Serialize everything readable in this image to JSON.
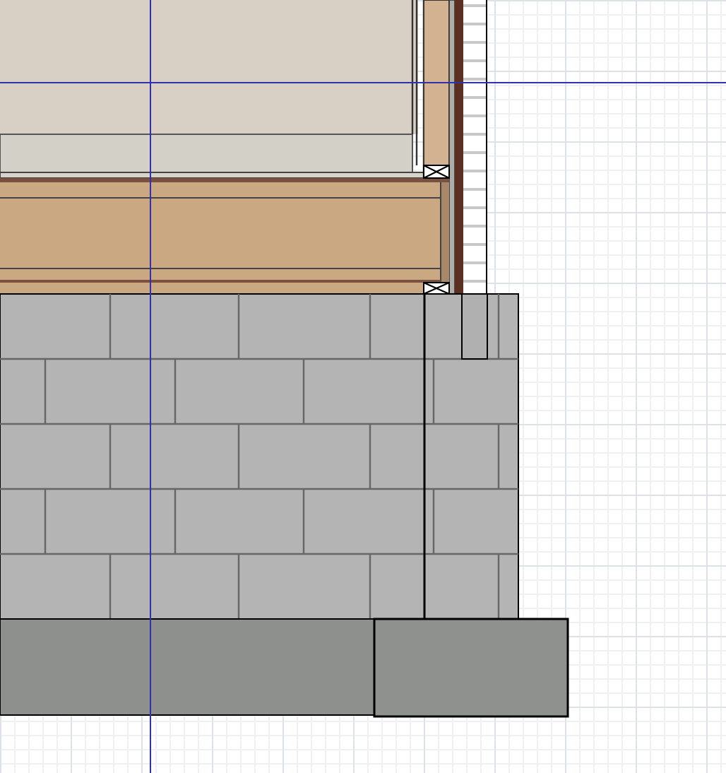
{
  "view": {
    "grid_visible": true,
    "guides_visible": true
  }
}
